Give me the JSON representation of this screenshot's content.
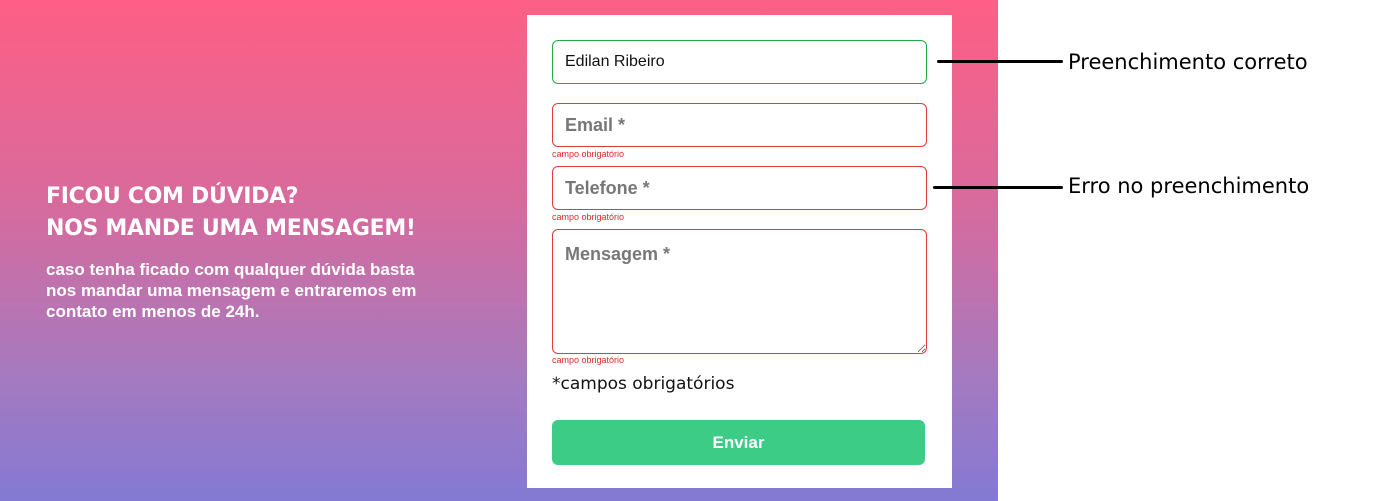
{
  "hero": {
    "heading_line1": "FICOU COM DÚVIDA?",
    "heading_line2": "NOS MANDE UMA MENSAGEM!",
    "subtext": "caso tenha ficado com qualquer dúvida basta nos mandar uma mensagem e entraremos em contato em menos de 24h."
  },
  "form": {
    "name": {
      "value": "Edilan Ribeiro",
      "state": "valid"
    },
    "email": {
      "placeholder": "Email *",
      "state": "error",
      "error": "campo obrigatório"
    },
    "phone": {
      "placeholder": "Telefone *",
      "state": "error",
      "error": "campo obrigatório"
    },
    "message": {
      "placeholder": "Mensagem *",
      "state": "error",
      "error": "campo obrigatório"
    },
    "required_note": "*campos obrigatórios",
    "submit_label": "Enviar"
  },
  "annotations": {
    "correct": "Preenchimento correto",
    "error": "Erro no preenchimento"
  },
  "colors": {
    "gradient_top": "#fe5f85",
    "gradient_bottom": "#8479d3",
    "valid_border": "#28a745",
    "error_border": "#e03a3a",
    "error_text": "#d92b2b",
    "submit_bg": "#3ccc86"
  }
}
